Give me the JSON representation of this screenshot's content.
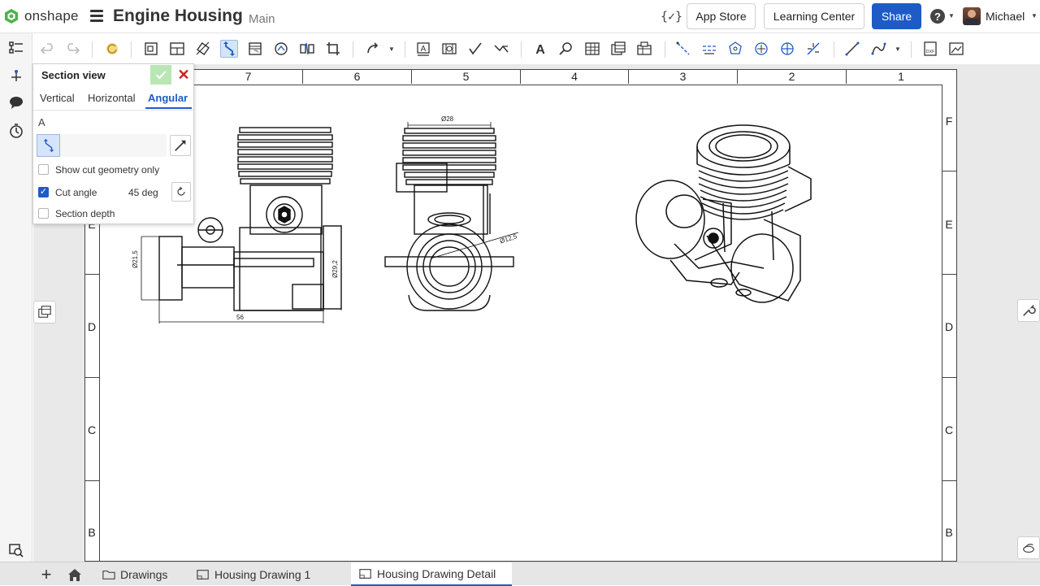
{
  "app": {
    "brand": "onshape",
    "doc_title": "Engine Housing",
    "branch": "Main"
  },
  "header": {
    "variable_icon": "{✓}",
    "app_store": "App Store",
    "learning_center": "Learning Center",
    "share": "Share",
    "help": "?",
    "user_name": "Michael"
  },
  "dialog": {
    "title": "Section view",
    "tabs": [
      "Vertical",
      "Horizontal",
      "Angular"
    ],
    "active_tab": "Angular",
    "selection_letter": "A",
    "options": [
      {
        "label": "Show cut geometry only",
        "checked": false
      },
      {
        "label": "Cut angle",
        "checked": true
      },
      {
        "label": "Section depth",
        "checked": false
      }
    ],
    "cut_angle_value": "45 deg"
  },
  "sheet": {
    "top_zones": [
      "7",
      "6",
      "5",
      "4",
      "3",
      "2",
      "1"
    ],
    "side_zones_left": [
      "E",
      "D",
      "C",
      "B"
    ],
    "side_zones_right": [
      "F",
      "E",
      "D",
      "C",
      "B"
    ],
    "dimensions": {
      "bore_width": "Ø28",
      "left_diameter": "Ø21,5",
      "right_diameter": "Ø29,2",
      "length": "56",
      "front_diameter": "Ø12,5"
    }
  },
  "tabs": [
    {
      "label": "Drawings",
      "type": "folder",
      "active": false
    },
    {
      "label": "Housing Drawing 1",
      "type": "drawing",
      "active": false
    },
    {
      "label": "Housing Drawing Detail",
      "type": "drawing",
      "active": true
    }
  ],
  "colors": {
    "accent": "#1e5bc6",
    "ok_green": "#b8e6b5",
    "close_red": "#d21e1e",
    "brand_green": "#4db14a"
  }
}
